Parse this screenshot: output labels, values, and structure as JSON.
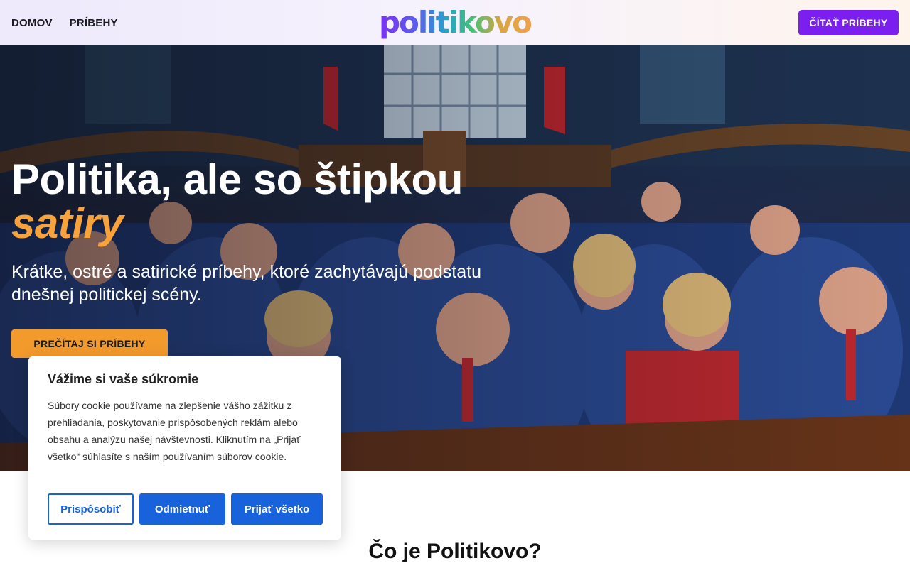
{
  "header": {
    "nav": [
      "DOMOV",
      "PRÍBEHY"
    ],
    "logo": "politikovo",
    "cta": "ČÍTAŤ PRÍBEHY"
  },
  "hero": {
    "title": "Politika, ale so štipkou",
    "title_accent": "satiry",
    "subtitle": "Krátke, ostré a satirické príbehy, ktoré zachytávajú podstatu dnešnej politickej scény.",
    "cta": "PREČÍTAJ SI PRÍBEHY",
    "image": "parliament-caricature-illustration"
  },
  "section": {
    "title": "Čo je Politikovo?"
  },
  "cookie": {
    "title": "Vážime si vaše súkromie",
    "body": "Súbory cookie používame na zlepšenie vášho zážitku z prehliadania, poskytovanie prispôsobených reklám alebo obsahu a analýzu našej návštevnosti. Kliknutím na „Prijať všetko“ súhlasíte s naším používaním súborov cookie.",
    "customize": "Prispôsobiť",
    "reject": "Odmietnuť",
    "accept": "Prijať všetko"
  },
  "colors": {
    "accent_purple": "#7a1ff0",
    "accent_orange": "#f39a2c",
    "cookie_blue": "#1863dc"
  }
}
